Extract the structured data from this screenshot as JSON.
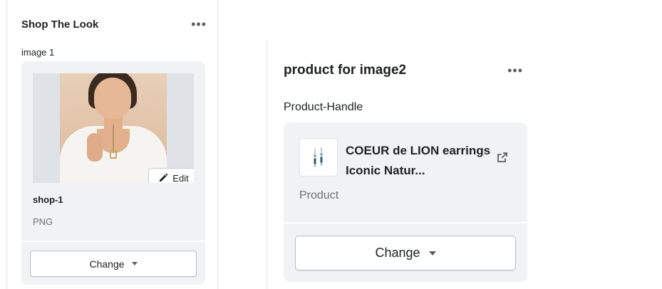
{
  "left_panel": {
    "title": "Shop The Look",
    "menu_icon": "more-horizontal-icon",
    "image_label": "image 1",
    "image_card": {
      "edit_label": "Edit",
      "edit_icon": "pencil-icon",
      "file_name": "shop-1",
      "file_type": "PNG",
      "change_label": "Change"
    }
  },
  "right_panel": {
    "title": "product for image2",
    "menu_icon": "more-horizontal-icon",
    "field_label": "Product-Handle",
    "product_card": {
      "thumbnail_icon": "earrings-product-thumbnail",
      "product_name": "COEUR de LION earrings Iconic Natur...",
      "external_link_icon": "external-link-icon",
      "product_kind": "Product",
      "change_label": "Change"
    }
  },
  "colors": {
    "card_bg": "#f1f2f3",
    "text_primary": "#202223",
    "text_subdued": "#6d7175",
    "border": "#babfc3"
  }
}
